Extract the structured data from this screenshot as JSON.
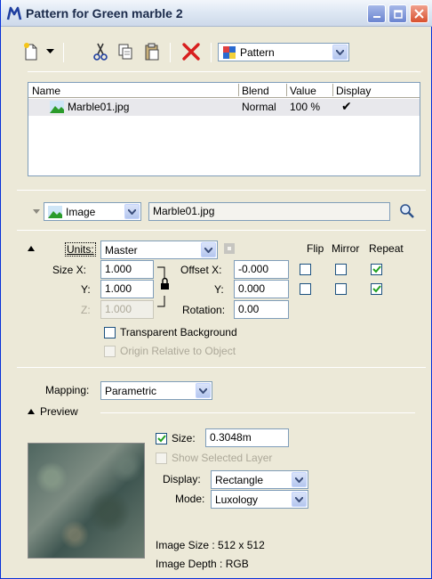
{
  "window": {
    "title": "Pattern for Green marble 2"
  },
  "toolbar": {
    "pattern_select": "Pattern"
  },
  "list": {
    "headers": {
      "name": "Name",
      "blend": "Blend",
      "value": "Value",
      "display": "Display"
    },
    "rows": [
      {
        "name": "Marble01.jpg",
        "blend": "Normal",
        "value": "100 %",
        "display": "✔"
      }
    ]
  },
  "layer": {
    "type": "Image",
    "file": "Marble01.jpg"
  },
  "settings": {
    "units_label": "Units:",
    "units_value": "Master",
    "flip_label": "Flip",
    "mirror_label": "Mirror",
    "repeat_label": "Repeat",
    "size_x_label": "Size X:",
    "size_x": "1.000",
    "size_y_label": "Y:",
    "size_y": "1.000",
    "size_z_label": "Z:",
    "size_z": "1.000",
    "offset_x_label": "Offset X:",
    "offset_x": "-0.000",
    "offset_y_label": "Y:",
    "offset_y": "0.000",
    "rotation_label": "Rotation:",
    "rotation": "0.00",
    "transparent_bg": "Transparent Background",
    "origin_relative": "Origin Relative to Object",
    "flip_x": false,
    "mirror_x": false,
    "repeat_x": true,
    "flip_y": false,
    "mirror_y": false,
    "repeat_y": true
  },
  "mapping": {
    "label": "Mapping:",
    "value": "Parametric"
  },
  "preview": {
    "label": "Preview",
    "size_label": "Size:",
    "size_value": "0.3048m",
    "size_checked": true,
    "show_selected_layer": "Show Selected Layer",
    "display_label": "Display:",
    "display_value": "Rectangle",
    "mode_label": "Mode:",
    "mode_value": "Luxology",
    "image_size": "Image Size : 512 x 512",
    "image_depth": "Image Depth : RGB"
  }
}
